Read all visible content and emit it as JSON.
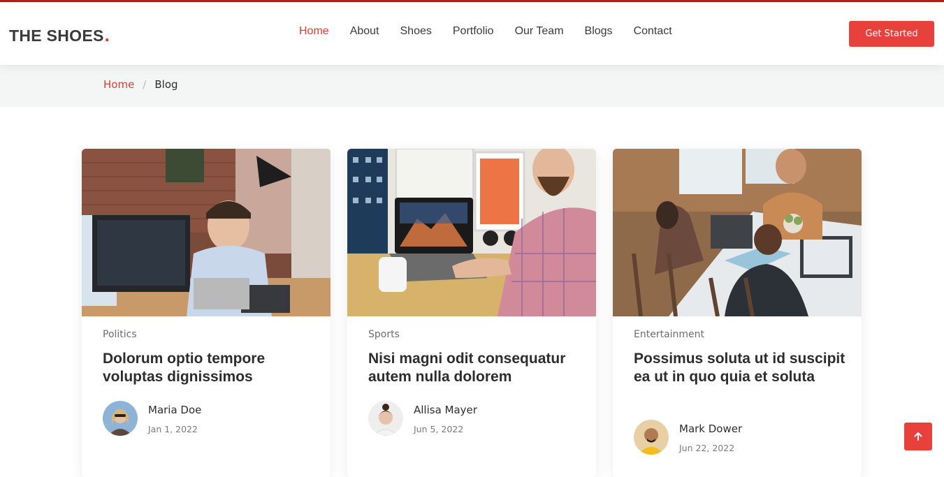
{
  "brand": {
    "name": "THE SHOES",
    "dot": ".",
    "accent": "#e03c31"
  },
  "nav": {
    "items": [
      {
        "label": "Home",
        "active": true
      },
      {
        "label": "About"
      },
      {
        "label": "Shoes"
      },
      {
        "label": "Portfolio"
      },
      {
        "label": "Our Team"
      },
      {
        "label": "Blogs"
      },
      {
        "label": "Contact"
      }
    ],
    "cta_label": "Get Started"
  },
  "breadcrumb": {
    "home": "Home",
    "separator": "/",
    "current": "Blog"
  },
  "posts": [
    {
      "category": "Politics",
      "title": "Dolorum optio tempore voluptas dignissimos",
      "author": "Maria Doe",
      "date": "Jan 1, 2022"
    },
    {
      "category": "Sports",
      "title": "Nisi magni odit consequatur autem nulla dolorem",
      "author": "Allisa Mayer",
      "date": "Jun 5, 2022"
    },
    {
      "category": "Entertainment",
      "title": "Possimus soluta ut id suscipit ea ut in quo quia et soluta",
      "author": "Mark Dower",
      "date": "Jun 22, 2022"
    }
  ],
  "scroll_top_icon": "arrow-up-icon"
}
